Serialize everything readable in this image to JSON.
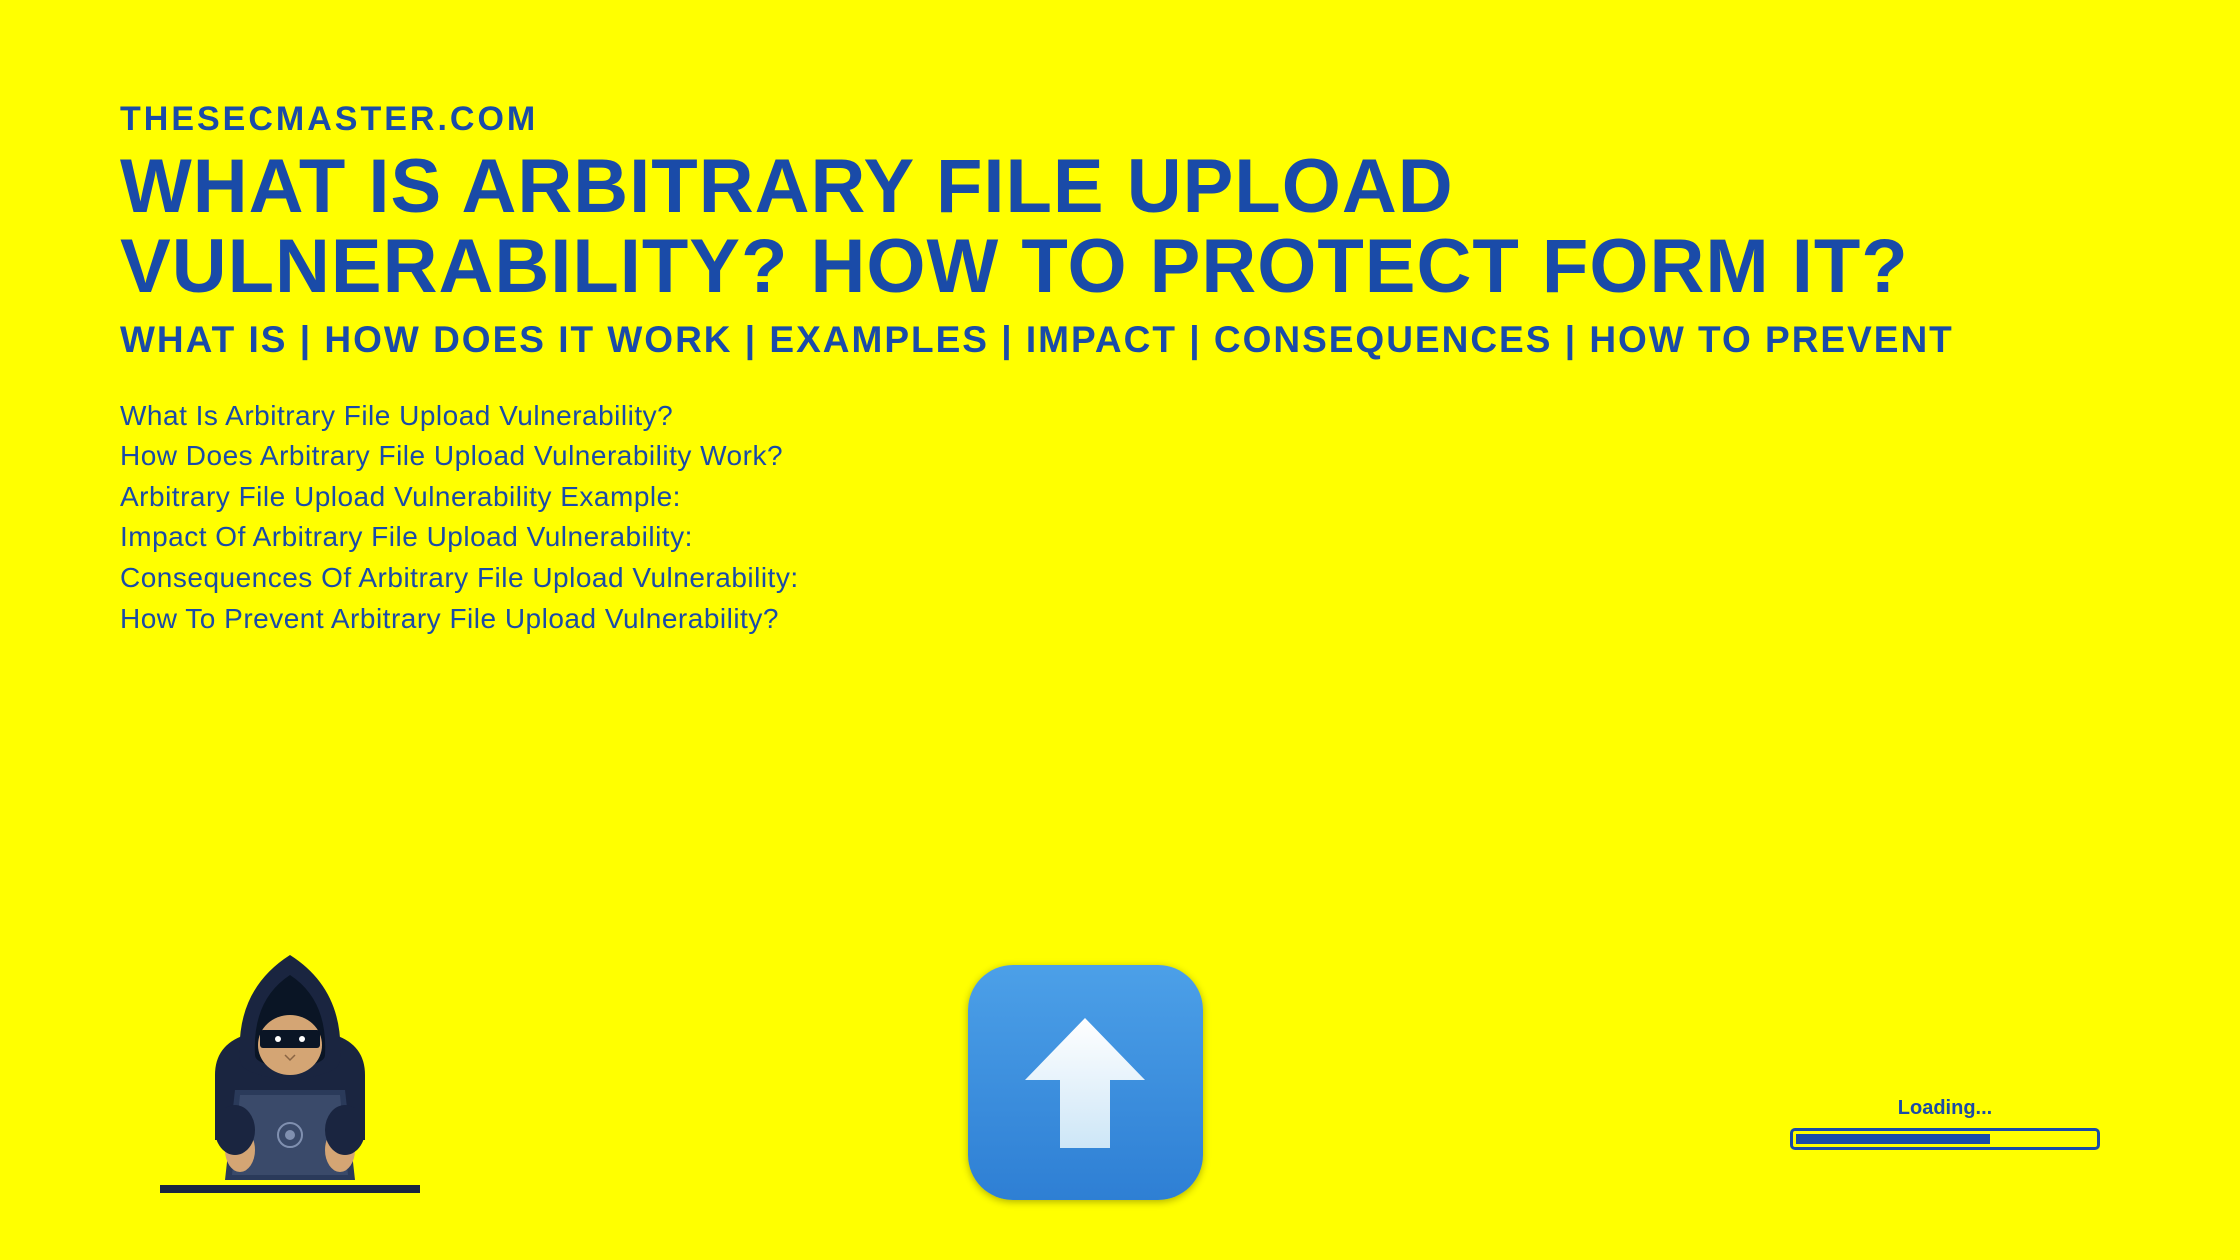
{
  "site_name": "THESECMASTER.COM",
  "main_title": "WHAT IS ARBITRARY FILE UPLOAD VULNERABILITY? HOW TO PROTECT FORM IT?",
  "subtitle": "WHAT IS | HOW DOES IT WORK | EXAMPLES | IMPACT | CONSEQUENCES | HOW TO PREVENT",
  "topics": [
    "What Is Arbitrary File Upload Vulnerability?",
    "How Does Arbitrary File Upload Vulnerability Work?",
    "Arbitrary File Upload Vulnerability Example:",
    "Impact Of Arbitrary File Upload Vulnerability:",
    "Consequences Of Arbitrary File Upload Vulnerability:",
    "How To Prevent Arbitrary File Upload Vulnerability?"
  ],
  "loading": {
    "label": "Loading...",
    "progress_percent": 65
  },
  "colors": {
    "background": "#FFFF00",
    "primary": "#1a4ba8",
    "upload_icon_start": "#4ca0e8",
    "upload_icon_end": "#2e7fd4"
  }
}
